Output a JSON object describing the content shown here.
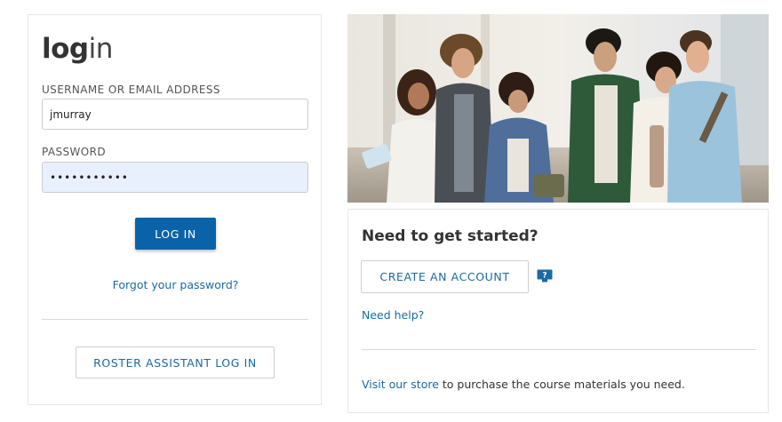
{
  "login": {
    "title_bold": "log",
    "title_light": "in",
    "username_label": "USERNAME OR EMAIL ADDRESS",
    "username_value": "jmurray",
    "password_label": "PASSWORD",
    "password_value": "•••••••••••",
    "login_button": "LOG IN",
    "forgot_link": "Forgot your password?",
    "roster_button": "ROSTER ASSISTANT LOG IN"
  },
  "getting_started": {
    "title": "Need to get started?",
    "create_account_button": "CREATE AN ACCOUNT",
    "help_icon": "help-question-icon",
    "need_help_link": "Need help?",
    "store_link": "Visit our store",
    "store_text": " to purchase the course materials you need."
  },
  "hero_image": {
    "subject": "students-walking-photo"
  },
  "colors": {
    "primary_button": "#0a63a8",
    "link": "#1a6aa3",
    "password_fill": "#e8f0fe"
  }
}
